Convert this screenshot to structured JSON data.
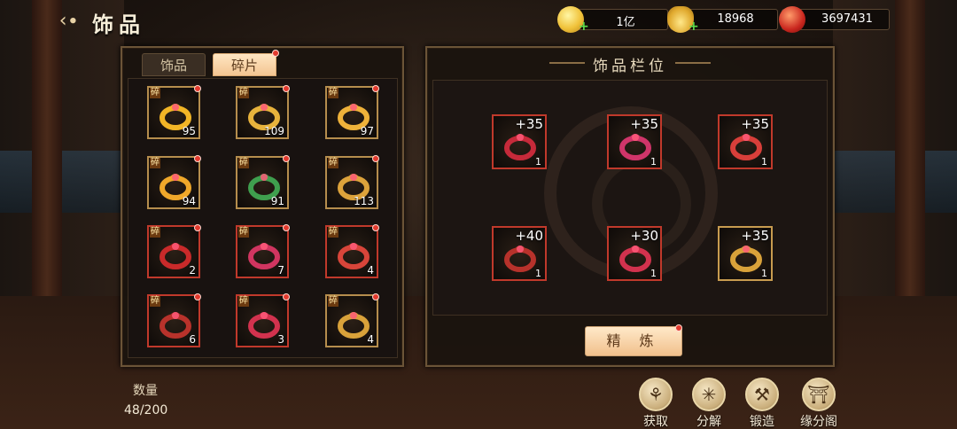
{
  "header": {
    "title": "饰品",
    "back_icon": "back-arrow-icon"
  },
  "resources": [
    {
      "name": "gold-coin",
      "value": "1亿"
    },
    {
      "name": "silver-ingot",
      "value": "18968"
    },
    {
      "name": "red-token",
      "value": "3697431"
    }
  ],
  "tabs": {
    "accessories": "饰品",
    "fragments": "碎片",
    "active": "fragments"
  },
  "fragment_badge": "碎",
  "fragments": [
    {
      "count": "95",
      "frame": "gold",
      "color": "#f2b526"
    },
    {
      "count": "109",
      "frame": "gold",
      "color": "#e8b33c"
    },
    {
      "count": "97",
      "frame": "gold",
      "color": "#efb23a"
    },
    {
      "count": "94",
      "frame": "gold",
      "color": "#f0a82a"
    },
    {
      "count": "91",
      "frame": "gold",
      "color": "#3f9f4e"
    },
    {
      "count": "113",
      "frame": "gold",
      "color": "#dda33b"
    },
    {
      "count": "2",
      "frame": "red",
      "color": "#c92a2a"
    },
    {
      "count": "7",
      "frame": "red",
      "color": "#d03560"
    },
    {
      "count": "4",
      "frame": "red",
      "color": "#d8453a"
    },
    {
      "count": "6",
      "frame": "red",
      "color": "#b8322b"
    },
    {
      "count": "3",
      "frame": "red",
      "color": "#d2324e"
    },
    {
      "count": "4",
      "frame": "gold",
      "color": "#d9a23a"
    }
  ],
  "slots_panel": {
    "title": "饰品栏位",
    "slots": [
      {
        "plus": "+35",
        "level": "1",
        "frame": "red",
        "color": "#c62a3a"
      },
      {
        "plus": "+35",
        "level": "1",
        "frame": "red",
        "color": "#d0356a"
      },
      {
        "plus": "+35",
        "level": "1",
        "frame": "red",
        "color": "#d83f3a"
      },
      {
        "plus": "+40",
        "level": "1",
        "frame": "red",
        "color": "#b7322b"
      },
      {
        "plus": "+30",
        "level": "1",
        "frame": "red",
        "color": "#d2324e"
      },
      {
        "plus": "+35",
        "level": "1",
        "frame": "gold",
        "color": "#d9a23a"
      }
    ],
    "refine_button": "精 炼"
  },
  "quantity": {
    "label": "数量",
    "value": "48/200"
  },
  "actions": [
    {
      "label": "获取",
      "icon": "obtain-icon"
    },
    {
      "label": "分解",
      "icon": "decompose-icon"
    },
    {
      "label": "锻造",
      "icon": "forge-hammer-icon"
    },
    {
      "label": "缘分阁",
      "icon": "pavilion-icon"
    }
  ]
}
